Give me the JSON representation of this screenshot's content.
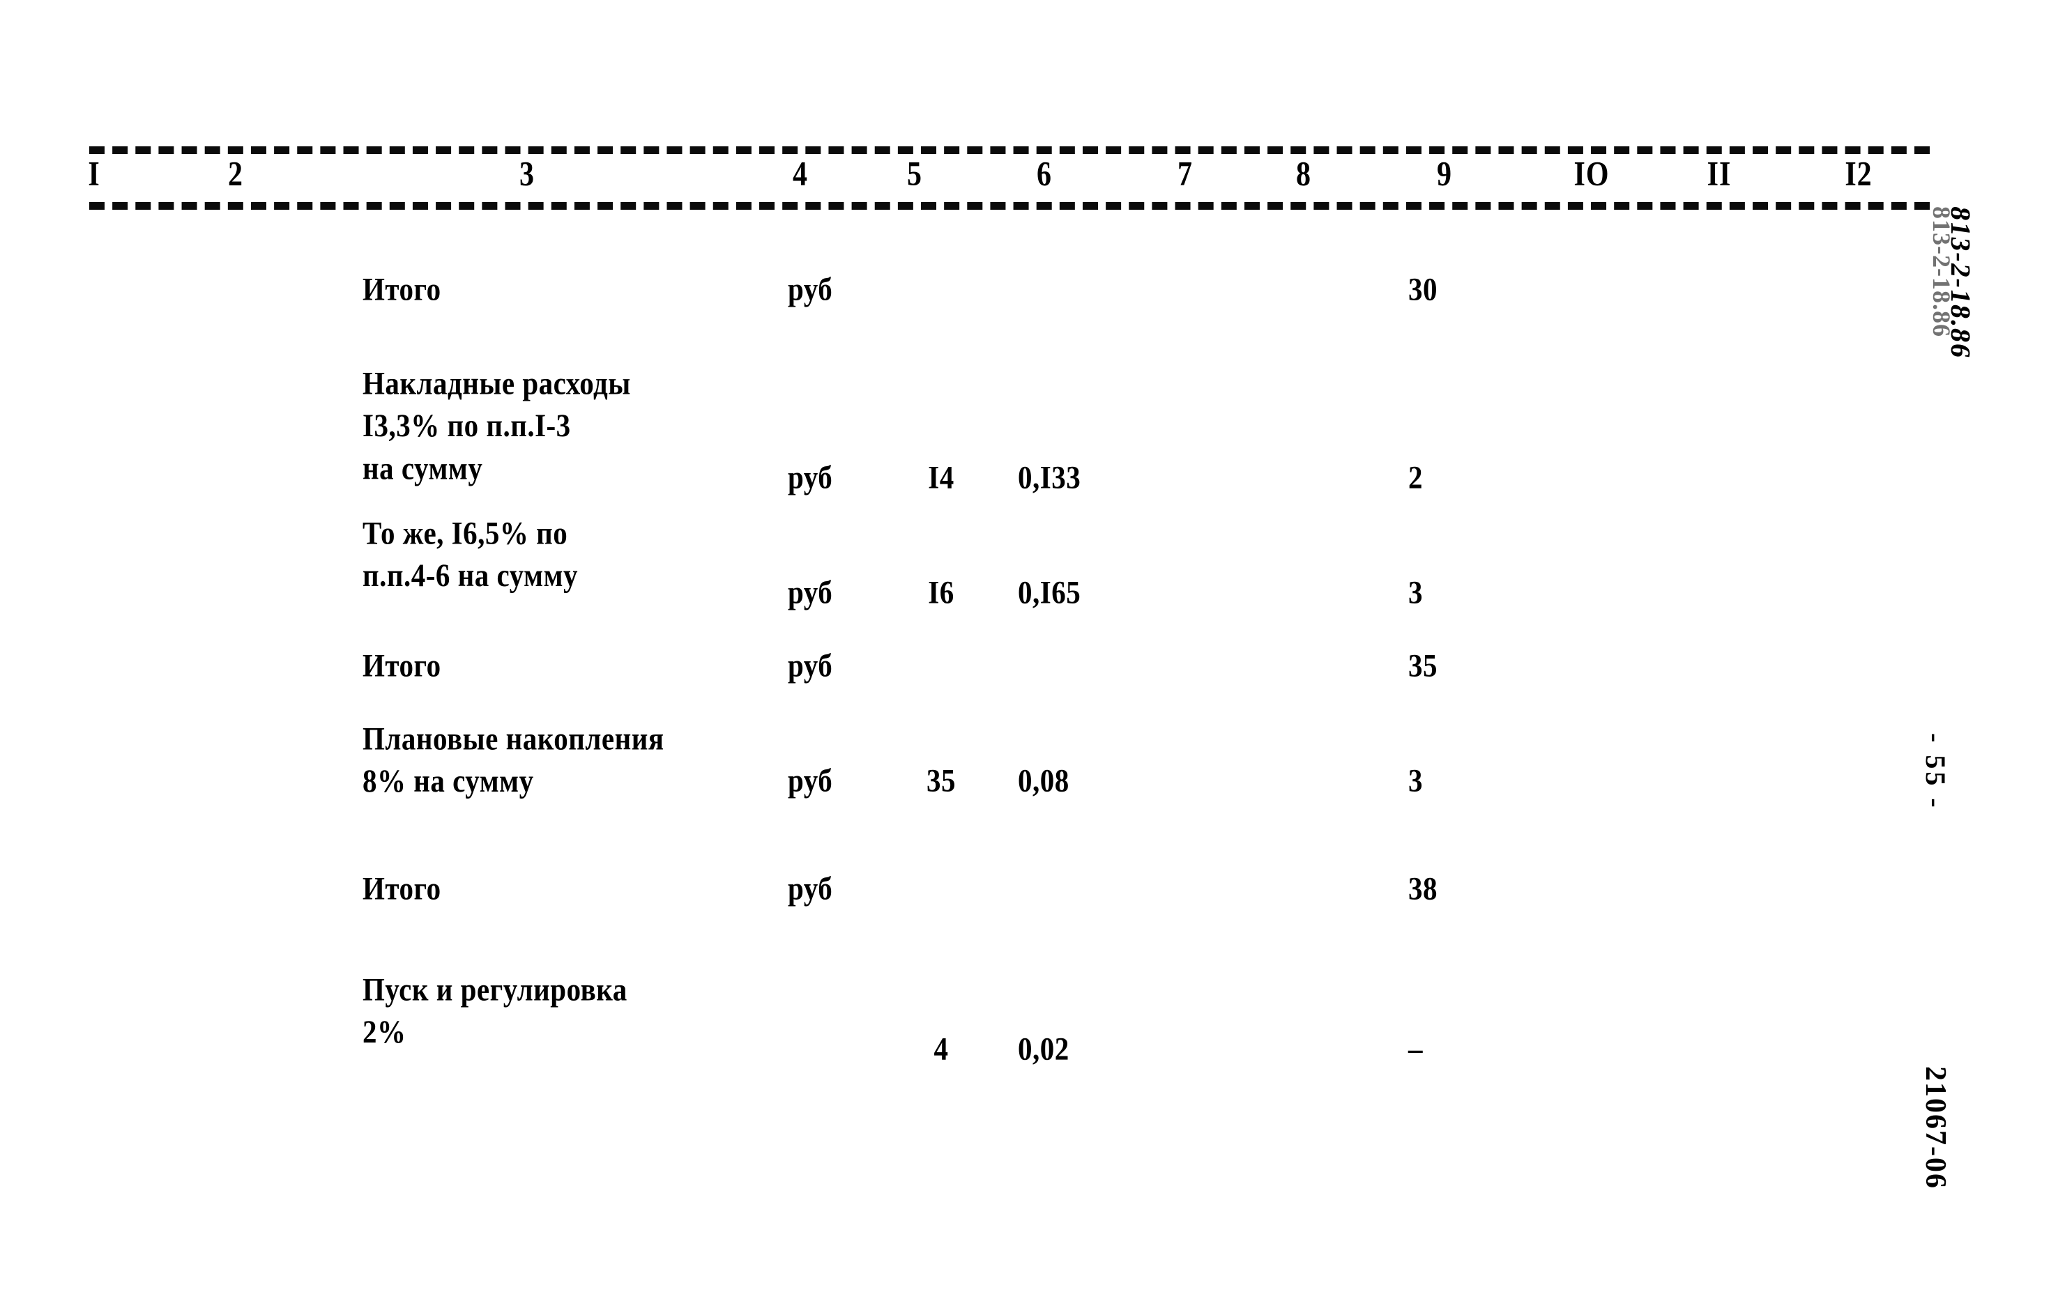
{
  "document": {
    "kind": "scanned-cost-estimate-table",
    "column_headers": [
      "I",
      "2",
      "3",
      "4",
      "5",
      "6",
      "7",
      "8",
      "9",
      "IO",
      "II",
      "I2"
    ],
    "margin": {
      "doc_code": "813-2-18.86",
      "page_number": "- 55 -",
      "sheet_code": "21067-06"
    }
  },
  "table": {
    "rows": [
      {
        "name": "Итого",
        "unit": "руб",
        "quantity": "",
        "rate": "",
        "total": "30"
      },
      {
        "name": "Накладные расходы\nI3,3% по п.п.I-3\nна сумму",
        "unit": "руб",
        "quantity": "I4",
        "rate": "0,I33",
        "total": "2"
      },
      {
        "name": "То же, I6,5% по\nп.п.4-6 на сумму",
        "unit": "руб",
        "quantity": "I6",
        "rate": "0,I65",
        "total": "3"
      },
      {
        "name": "Итого",
        "unit": "руб",
        "quantity": "",
        "rate": "",
        "total": "35"
      },
      {
        "name": "Плановые накопления\n8% на сумму",
        "unit": "руб",
        "quantity": "35",
        "rate": "0,08",
        "total": "3"
      },
      {
        "name": "Итого",
        "unit": "руб",
        "quantity": "",
        "rate": "",
        "total": "38"
      },
      {
        "name": "Пуск и регулировка\n2%",
        "unit": "",
        "quantity": "4",
        "rate": "0,02",
        "total": "–"
      }
    ]
  }
}
